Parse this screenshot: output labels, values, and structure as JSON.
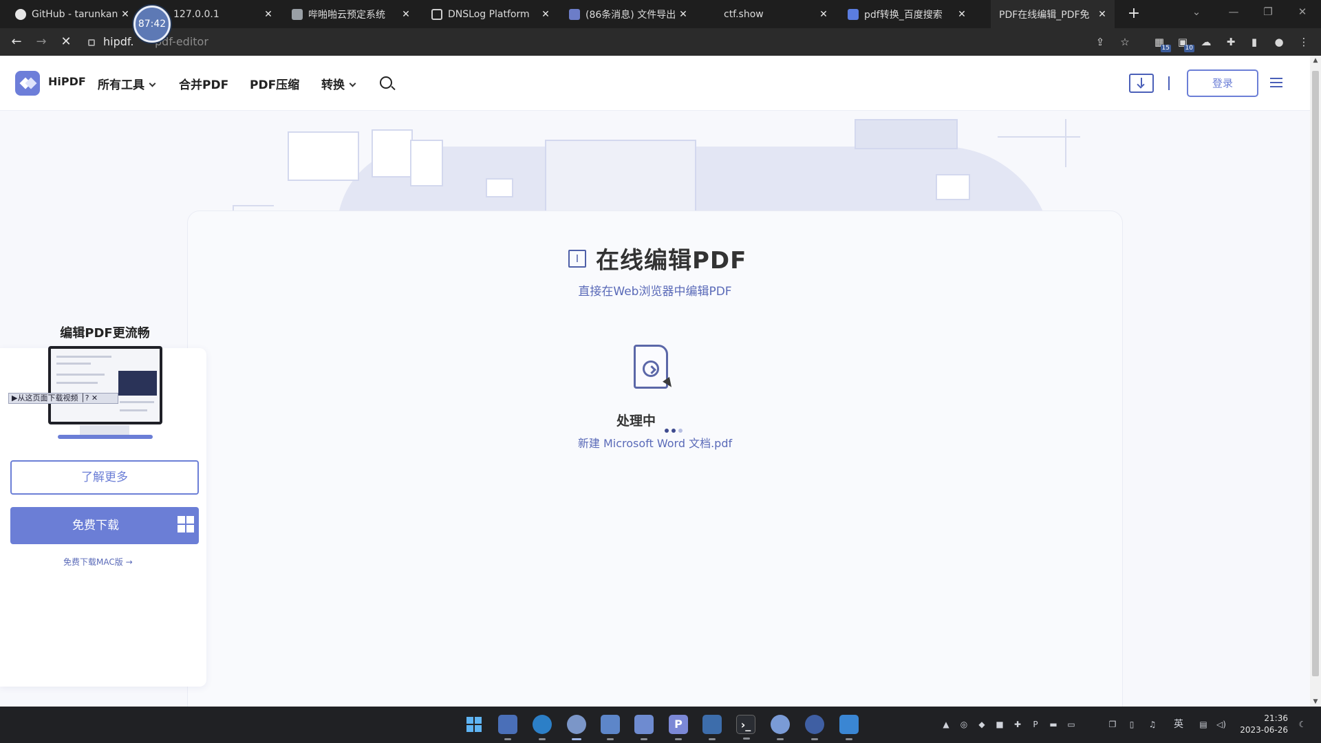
{
  "browser": {
    "tabs": [
      {
        "label": "GitHub - tarunkant",
        "favicon": "github-icon",
        "active": false
      },
      {
        "label": "127.0.0.1",
        "favicon": "globe-icon",
        "active": false
      },
      {
        "label": "哔啪啪云预定系统",
        "favicon": "site-icon",
        "active": false
      },
      {
        "label": "DNSLog Platform",
        "favicon": "file-icon",
        "active": false
      },
      {
        "label": "(86条消息) 文件导出",
        "favicon": "csdn-icon",
        "active": false
      },
      {
        "label": "ctf.show",
        "favicon": "site-icon",
        "active": false
      },
      {
        "label": "pdf转换_百度搜索",
        "favicon": "baidu-icon",
        "active": false
      },
      {
        "label": "PDF在线编辑_PDF免",
        "favicon": "hipdf-icon",
        "active": true
      }
    ],
    "address": {
      "host": "hipdf.",
      "path": "pdf-editor"
    },
    "timer_badge": "87:42",
    "extension_badges": {
      "first": "15",
      "second": "10"
    }
  },
  "site": {
    "brand": "HiPDF",
    "nav": [
      {
        "label": "所有工具",
        "has_dropdown": true
      },
      {
        "label": "合并PDF",
        "has_dropdown": false
      },
      {
        "label": "PDF压缩",
        "has_dropdown": false
      },
      {
        "label": "转换",
        "has_dropdown": true
      }
    ],
    "login_label": "登录"
  },
  "main": {
    "title": "在线编辑PDF",
    "subtitle": "直接在Web浏览器中编辑PDF",
    "status": "处理中",
    "filename": "新建 Microsoft Word 文档.pdf"
  },
  "promo": {
    "title": "编辑PDF更流畅",
    "video_toolbar": "▶从这页面下载视频 │? ✕",
    "learn_more": "了解更多",
    "free_download": "免费下载",
    "mac_link": "免费下载MAC版"
  },
  "taskbar": {
    "apps": [
      "windows-start-icon",
      "file-explorer-icon",
      "edge-icon",
      "chrome-icon",
      "app-icon",
      "photos-icon",
      "p-app-icon",
      "bird-icon",
      "terminal-icon",
      "cloud-icon",
      "steam-icon",
      "vscode-icon"
    ],
    "ime": "英",
    "time": "21:36",
    "date": "2023-06-26"
  },
  "colors": {
    "accent": "#6b7ed6",
    "accent_dark": "#4a5fb8",
    "chrome_dark": "#1e1e1e"
  }
}
